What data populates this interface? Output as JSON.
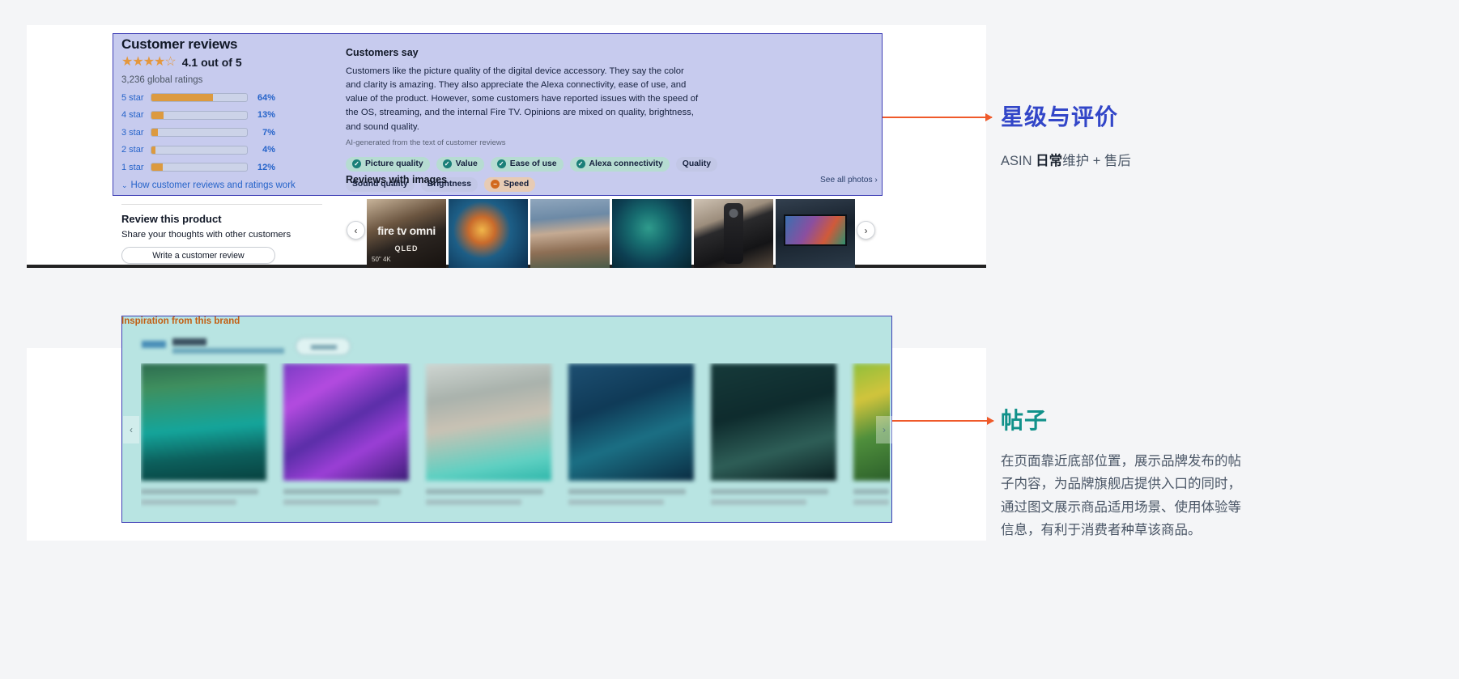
{
  "reviews_panel": {
    "customer_reviews": {
      "title": "Customer reviews",
      "stars_filled": 4,
      "stars_glyph": "★★★★☆",
      "score_text": "4.1 out of 5",
      "global_ratings": "3,236 global ratings",
      "how_link": "How customer reviews and ratings work",
      "chevron": "⌄",
      "distribution": [
        {
          "label": "5 star",
          "percent": 64,
          "percent_text": "64%"
        },
        {
          "label": "4 star",
          "percent": 13,
          "percent_text": "13%"
        },
        {
          "label": "3 star",
          "percent": 7,
          "percent_text": "7%"
        },
        {
          "label": "2 star",
          "percent": 4,
          "percent_text": "4%"
        },
        {
          "label": "1 star",
          "percent": 12,
          "percent_text": "12%"
        }
      ]
    },
    "customers_say": {
      "title": "Customers say",
      "body": "Customers like the picture quality of the digital device accessory. They say the color and clarity is amazing. They also appreciate the Alexa connectivity, ease of use, and value of the product. However, some customers have reported issues with the speed of the OS, streaming, and the internal Fire TV. Opinions are mixed on quality, brightness, and sound quality.",
      "note": "AI-generated from the text of customer reviews",
      "chips": [
        {
          "label": "Picture quality",
          "sentiment": "pos",
          "icon": "check-circle-icon",
          "glyph": "✓"
        },
        {
          "label": "Value",
          "sentiment": "pos",
          "icon": "check-circle-icon",
          "glyph": "✓"
        },
        {
          "label": "Ease of use",
          "sentiment": "pos",
          "icon": "check-circle-icon",
          "glyph": "✓"
        },
        {
          "label": "Alexa connectivity",
          "sentiment": "pos",
          "icon": "check-circle-icon",
          "glyph": "✓"
        },
        {
          "label": "Quality",
          "sentiment": "neu",
          "icon": "none",
          "glyph": ""
        },
        {
          "label": "Sound quality",
          "sentiment": "neu",
          "icon": "none",
          "glyph": ""
        },
        {
          "label": "Brightness",
          "sentiment": "neu",
          "icon": "none",
          "glyph": ""
        },
        {
          "label": "Speed",
          "sentiment": "neg",
          "icon": "minus-circle-icon",
          "glyph": "−"
        }
      ]
    },
    "reviews_with_images": {
      "title": "Reviews with images",
      "see_all": "See all photos ›",
      "prev": "‹",
      "next": "›",
      "thumbs": [
        {
          "name": "fire-tv-omni-box",
          "brand_text": "fire tv omni",
          "sub_text": "QLED",
          "size_text": "50\" 4K"
        },
        {
          "name": "clownfish-reef-photo"
        },
        {
          "name": "crowd-parade-photo"
        },
        {
          "name": "sea-turtle-photo"
        },
        {
          "name": "remote-control-photo"
        },
        {
          "name": "tv-on-stand-photo"
        }
      ]
    },
    "review_this_product": {
      "title": "Review this product",
      "subtitle": "Share your thoughts with other customers",
      "button": "Write a customer review"
    }
  },
  "inspiration_panel": {
    "title": "Inspiration from this brand",
    "follow_label": "Follow",
    "prev": "‹",
    "next": "›",
    "cards": [
      {
        "name": "post-card-1"
      },
      {
        "name": "post-card-2"
      },
      {
        "name": "post-card-3"
      },
      {
        "name": "post-card-4"
      },
      {
        "name": "post-card-5"
      },
      {
        "name": "post-card-6-partial"
      }
    ]
  },
  "annotations": {
    "top": {
      "title": "星级与评价",
      "body_prefix": "ASIN ",
      "body_bold": "日常",
      "body_suffix": "维护 + 售后",
      "color": "#3246c8",
      "arrow_color": "#ef5a2a"
    },
    "bottom": {
      "title": "帖子",
      "body": "在页面靠近底部位置，展示品牌发布的帖子内容，为品牌旗舰店提供入口的同时，通过图文展示商品适用场景、使用体验等信息，有利于消费者种草该商品。",
      "color": "#11918a",
      "arrow_color": "#ef5a2a"
    }
  }
}
